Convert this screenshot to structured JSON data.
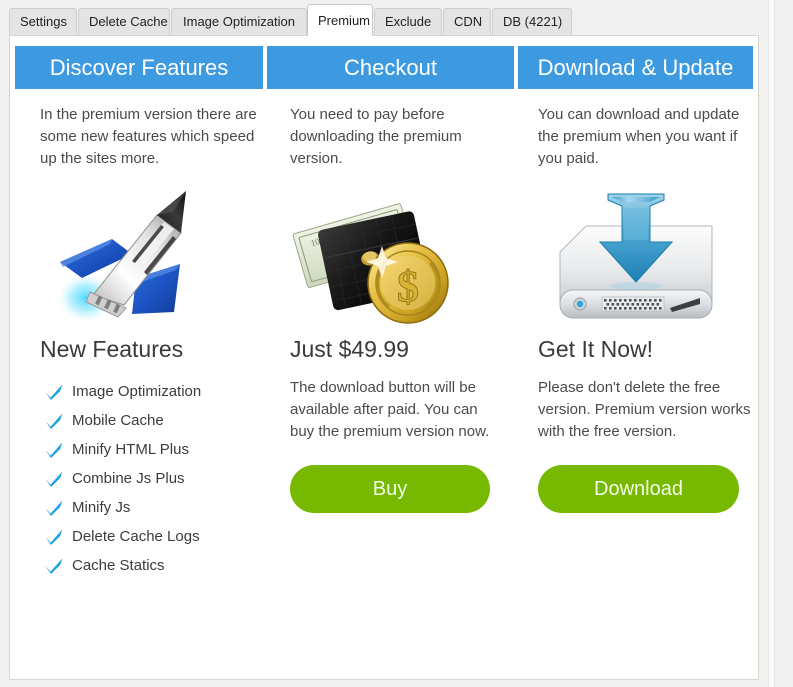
{
  "tabs": [
    {
      "label": "Settings",
      "active": false
    },
    {
      "label": "Delete Cache",
      "active": false
    },
    {
      "label": "Image Optimization",
      "active": false
    },
    {
      "label": "Premium",
      "active": true
    },
    {
      "label": "Exclude",
      "active": false
    },
    {
      "label": "CDN",
      "active": false
    },
    {
      "label": "DB (4221)",
      "active": false
    }
  ],
  "colors": {
    "banner_blue": "#3d9ae0",
    "button_green": "#76b900",
    "check_blue": "#1ea2e0",
    "text_gray": "#4b4b4b"
  },
  "columns": {
    "discover": {
      "banner": "Discover Features",
      "description": "In the premium version there are some new features which speed up the sites more.",
      "icon": "rocket-icon",
      "heading": "New Features",
      "features": [
        "Image Optimization",
        "Mobile Cache",
        "Minify HTML Plus",
        "Combine Js Plus",
        "Minify Js",
        "Delete Cache Logs",
        "Cache Statics"
      ]
    },
    "checkout": {
      "banner": "Checkout",
      "description": "You need to pay before downloading the premium version.",
      "icon": "wallet-money-icon",
      "heading": "Just $49.99",
      "body": "The download button will be available after paid. You can buy the premium version now.",
      "button_label": "Buy"
    },
    "download": {
      "banner": "Download & Update",
      "description": "You can download and update the premium when you want if you paid.",
      "icon": "hard-drive-download-icon",
      "heading": "Get It Now!",
      "body": "Please don't delete the free version. Premium version works with the free version.",
      "button_label": "Download"
    }
  }
}
